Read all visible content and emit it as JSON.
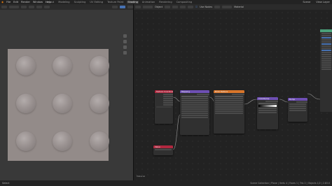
{
  "top_menu": [
    "File",
    "Edit",
    "Render",
    "Window",
    "Help"
  ],
  "workspace_tabs": [
    {
      "label": "Layout",
      "active": false
    },
    {
      "label": "Modeling",
      "active": false
    },
    {
      "label": "Sculpting",
      "active": false
    },
    {
      "label": "UV Editing",
      "active": false
    },
    {
      "label": "Texture Paint",
      "active": false
    },
    {
      "label": "Shading",
      "active": true
    },
    {
      "label": "Animation",
      "active": false
    },
    {
      "label": "Rendering",
      "active": false
    },
    {
      "label": "Compositing",
      "active": false
    }
  ],
  "scene_label": "Scene",
  "view_layer_label": "View Layer",
  "node_editor_header": {
    "object": "Object",
    "material": "Material",
    "use_nodes": "Use Nodes"
  },
  "nodes": {
    "texture_coordinate": "Texture Coordinate",
    "mapping": "Mapping",
    "brick_texture": "Brick Texture",
    "color_ramp": "ColorRamp",
    "bump": "Bump",
    "value": "Value",
    "principled": "Principled BSDF"
  },
  "editor_label": "Material",
  "status_bar": {
    "left": "Select",
    "right": "Scene Collection | Plane | Verts 4 | Faces 1 | Tris 2 | Objects 1/2 | 2.83.0"
  },
  "colors": {
    "accent": "#4772b3",
    "texture_node": "#d9762b",
    "vector_node": "#6e4fb3",
    "input_node": "#b0283f",
    "shader_node": "#4aa07a"
  }
}
